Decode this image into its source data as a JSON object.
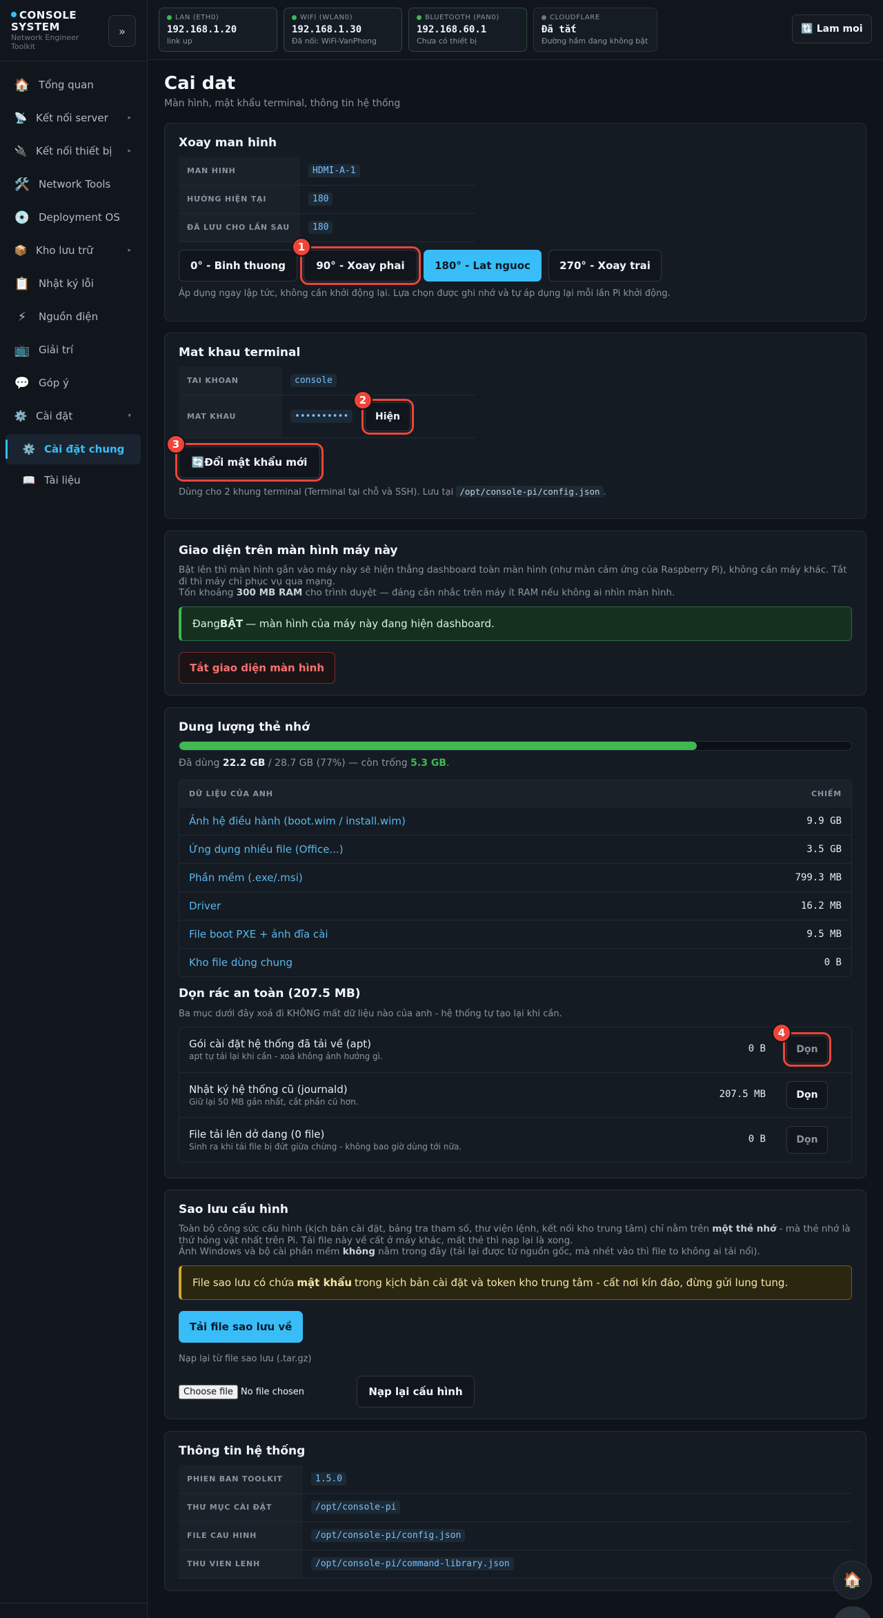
{
  "brand": {
    "title_line1": "CONSOLE",
    "title_line2": "SYSTEM",
    "subtitle_line1": "Network Engineer",
    "subtitle_line2": "Toolkit",
    "collapse_label": "»"
  },
  "sidebar": {
    "items": [
      {
        "label": "Tổng quan",
        "icon": "🏠"
      },
      {
        "label": "Kết nối server",
        "icon": "📡",
        "arrow": "▸"
      },
      {
        "label": "Kết nối thiết bị",
        "icon": "🔌",
        "arrow": "▸"
      },
      {
        "label": "Network Tools",
        "icon": "🛠️"
      },
      {
        "label": "Deployment OS",
        "icon": "💿"
      },
      {
        "label": "Kho lưu trữ",
        "icon": "📦",
        "arrow": "▸"
      },
      {
        "label": "Nhật ký lỗi",
        "icon": "📋"
      },
      {
        "label": "Nguồn điện",
        "icon": "⚡"
      },
      {
        "label": "Giải trí",
        "icon": "📺"
      },
      {
        "label": "Góp ý",
        "icon": "💬"
      },
      {
        "label": "Cài đặt",
        "icon": "⚙️",
        "arrow": "▾"
      },
      {
        "label": "Cài đặt chung",
        "icon": "⚙️"
      },
      {
        "label": "Tài liệu",
        "icon": "📖"
      }
    ]
  },
  "topbar": {
    "cards": [
      {
        "label": "LAN (ETH0)",
        "ip": "192.168.1.20",
        "note": "link up"
      },
      {
        "label": "WIFI (WLAN0)",
        "ip": "192.168.1.30",
        "note": "Đã nối: WiFi-VanPhong"
      },
      {
        "label": "BLUETOOTH (PAN0)",
        "ip": "192.168.60.1",
        "note": "Chưa có thiết bị"
      },
      {
        "label": "CLOUDFLARE",
        "ip": "Đã tắt",
        "note": "Đường hầm đang không bật"
      }
    ],
    "refresh_label": "🔃 Lam moi"
  },
  "page": {
    "title": "Cai dat",
    "subtitle": "Màn hình, mật khẩu terminal, thông tin hệ thống"
  },
  "rotate": {
    "title": "Xoay man hinh",
    "rows": [
      {
        "key": "MAN HINH",
        "value": "HDMI-A-1"
      },
      {
        "key": "HƯỚNG HIỆN TẠI",
        "value": "180"
      },
      {
        "key": "ĐÃ LƯU CHO LẦN SAU",
        "value": "180"
      }
    ],
    "buttons": [
      "0° - Binh thuong",
      "90° - Xoay phai",
      "180° - Lat nguoc",
      "270° - Xoay trai"
    ],
    "note": "Áp dụng ngay lập tức, không cần khởi động lại. Lựa chọn được ghi nhớ và tự áp dụng lại mỗi lần Pi khởi động."
  },
  "password": {
    "title": "Mat khau terminal",
    "account_key": "TAI KHOAN",
    "account_value": "console",
    "password_key": "MAT KHAU",
    "password_value": "••••••••••",
    "show_label": "Hiện",
    "change_label_prefix": "🔄 ",
    "change_label": "Đổi mật khẩu mới",
    "note_prefix": "Dùng cho 2 khung terminal (Terminal tại chỗ và SSH). Lưu tại",
    "note_path": "/opt/console-pi/config.json",
    "note_suffix": "."
  },
  "kiosk": {
    "title": "Giao diện trên màn hình máy này",
    "para1": "Bật lên thì màn hình gắn vào máy này sẽ hiện thẳng dashboard toàn màn hình (như màn cảm ứng của Raspberry Pi), không cần máy khác. Tắt đi thì máy chỉ phục vụ qua mạng.",
    "para2_prefix": "Tốn khoảng ",
    "para2_bold": "300 MB RAM",
    "para2_suffix": " cho trình duyệt — đáng cân nhắc trên máy ít RAM nếu không ai nhìn màn hình.",
    "status_prefix": "Đang ",
    "status_bold": "BẬT",
    "status_suffix": " — màn hình của máy này đang hiện dashboard.",
    "off_button": "Tắt giao diện màn hình"
  },
  "storage": {
    "title": "Dung lượng thẻ nhớ",
    "used_fraction": 0.77,
    "used_prefix": "Đã dùng ",
    "used": "22.2 GB",
    "total_part": " / 28.7 GB (77%) — còn trống ",
    "free": "5.3 GB",
    "free_suffix": ".",
    "table_header_name": "DỮ LIỆU CỦA ANH",
    "table_header_size": "CHIẾM",
    "rows": [
      {
        "name": "Ảnh hệ điều hành (boot.wim / install.wim)",
        "size": "9.9 GB"
      },
      {
        "name": "Ứng dụng nhiều file (Office...)",
        "size": "3.5 GB"
      },
      {
        "name": "Phần mềm (.exe/.msi)",
        "size": "799.3 MB"
      },
      {
        "name": "Driver",
        "size": "16.2 MB"
      },
      {
        "name": "File boot PXE + ảnh đĩa cài",
        "size": "9.5 MB"
      },
      {
        "name": "Kho file dùng chung",
        "size": "0 B"
      }
    ],
    "clean_title": "Dọn rác an toàn (207.5 MB)",
    "clean_note": "Ba mục dưới đây xoá đi KHÔNG mất dữ liệu nào của anh - hệ thống tự tạo lại khi cần.",
    "clean_rows": [
      {
        "title": "Gói cài đặt hệ thống đã tải về (apt)",
        "desc": "apt tự tải lại khi cần - xoá không ảnh hưởng gì.",
        "size": "0 B",
        "button": "Dọn"
      },
      {
        "title": "Nhật ký hệ thống cũ (journald)",
        "desc": "Giữ lại 50 MB gần nhất, cắt phần cũ hơn.",
        "size": "207.5 MB",
        "button": "Dọn"
      },
      {
        "title": "File tải lên dở dang (0 file)",
        "desc": "Sinh ra khi tải file bị đứt giữa chừng - không bao giờ dùng tới nữa.",
        "size": "0 B",
        "button": "Dọn"
      }
    ]
  },
  "backup": {
    "title": "Sao lưu cấu hình",
    "para1_prefix": "Toàn bộ công sức cấu hình (kịch bản cài đặt, bảng tra tham số, thư viện lệnh, kết nối kho trung tâm) chỉ nằm trên ",
    "para1_bold": "một thẻ nhớ",
    "para1_suffix": " - mà thẻ nhớ là thứ hỏng vặt nhất trên Pi. Tải file này về cất ở máy khác, mất thẻ thì nạp lại là xong.",
    "para2_prefix": "Ảnh Windows và bộ cài phần mềm ",
    "para2_bold": "không",
    "para2_suffix": " nằm trong đây (tải lại được từ nguồn gốc, mà nhét vào thì file to không ai tải nổi).",
    "warn_prefix": "File sao lưu có chứa ",
    "warn_bold": "mật khẩu",
    "warn_suffix": " trong kịch bản cài đặt và token kho trung tâm - cất nơi kín đáo, đừng gửi lung tung.",
    "download_button": "Tải file sao lưu về",
    "restore_label": "Nạp lại từ file sao lưu (.tar.gz)",
    "choose_file": "Choose file",
    "no_file": "No file chosen",
    "restore_button": "Nạp lại cấu hình"
  },
  "sysinfo": {
    "title": "Thông tin hệ thống",
    "rows": [
      {
        "key": "PHIEN BAN TOOLKIT",
        "value": "1.5.0"
      },
      {
        "key": "THƯ MỤC CÀI ĐẶT",
        "value": "/opt/console-pi"
      },
      {
        "key": "FILE CAU HINH",
        "value": "/opt/console-pi/config.json"
      },
      {
        "key": "THU VIEN LENH",
        "value": "/opt/console-pi/command-library.json"
      }
    ]
  },
  "annotations": [
    "1",
    "2",
    "3",
    "4"
  ],
  "fab_icon": "🏠",
  "colors": {
    "accent": "#38bdf8",
    "success": "#3fb950",
    "highlight": "#f04438"
  }
}
